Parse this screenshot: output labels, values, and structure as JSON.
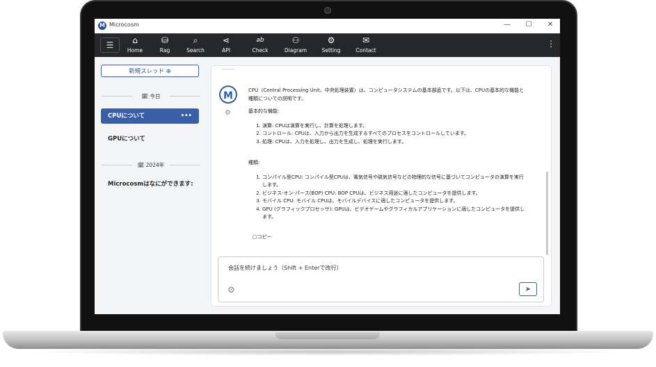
{
  "window": {
    "title": "Microcosm",
    "logo_letter": "M",
    "minimize": "—",
    "maximize": "☐",
    "close": "✕"
  },
  "toolbar": {
    "menu_icon": "☰",
    "items": [
      {
        "label": "Home",
        "icon": "home-icon",
        "glyph": "⌂"
      },
      {
        "label": "Rag",
        "icon": "database-icon",
        "glyph": "⛁"
      },
      {
        "label": "Search",
        "icon": "search-icon",
        "glyph": "⌕"
      },
      {
        "label": "API",
        "icon": "share-icon",
        "glyph": "⋖"
      },
      {
        "label": "Check",
        "icon": "spellcheck-icon",
        "glyph": "ab"
      },
      {
        "label": "Diagram",
        "icon": "diagram-icon",
        "glyph": "⚇"
      },
      {
        "label": "Setting",
        "icon": "gear-icon",
        "glyph": "⚙"
      },
      {
        "label": "Contact",
        "icon": "mail-icon",
        "glyph": "✉"
      }
    ],
    "more_icon": "⋮"
  },
  "sidebar": {
    "new_thread": "新規スレッド ⊕",
    "sections": [
      {
        "label": "🗓 今日",
        "threads": [
          {
            "title": "CPUについて",
            "active": true,
            "more": "•••"
          },
          {
            "title": "GPUについて",
            "active": false
          }
        ]
      },
      {
        "label": "🗓 2024年",
        "threads": [
          {
            "title": "Microcosmはなにができます:",
            "active": false
          }
        ]
      }
    ]
  },
  "chat": {
    "avatar_letter": "M",
    "intro": "CPU（Central Processing Unit、中央処理装置）は、コンピュータシステムの基本部品です。以下は、CPUの基本的な機能と種類についての説明です。",
    "section1_title": "基本的な機能:",
    "functions": [
      "演算: CPUは演算を実行し、計算を処理します。",
      "コントロール: CPUは、入力から出力を生成するすべてのプロセスをコントロールしています。",
      "処理: CPUは、入力を処理し、出力を生成し、処理を実行します。"
    ],
    "section2_title": "種類:",
    "types": [
      "コンパイル型CPU: コンパイル型CPUは、電気信号や磁気信号などの物理的な信号に基づいてコンピュータの演算を実行します。",
      "ビジネス-オン-パース(BOP) CPU: BOP CPUは、ビジネス用途に適したコンピュータを提供します。",
      "モバイル CPU: モバイル CPUは、モバイルデバイスに適したコンピュータを提供します。",
      "GPU (グラフィックプロセッサ): GPUは、ビデオゲームやグラフィカルアプリケーションに適したコンピュータを提供します。"
    ],
    "copy_label": "▢コピー"
  },
  "input": {
    "placeholder": "会話を続けましょう（Shift + Enterで改行）",
    "send_icon": "send-icon"
  }
}
